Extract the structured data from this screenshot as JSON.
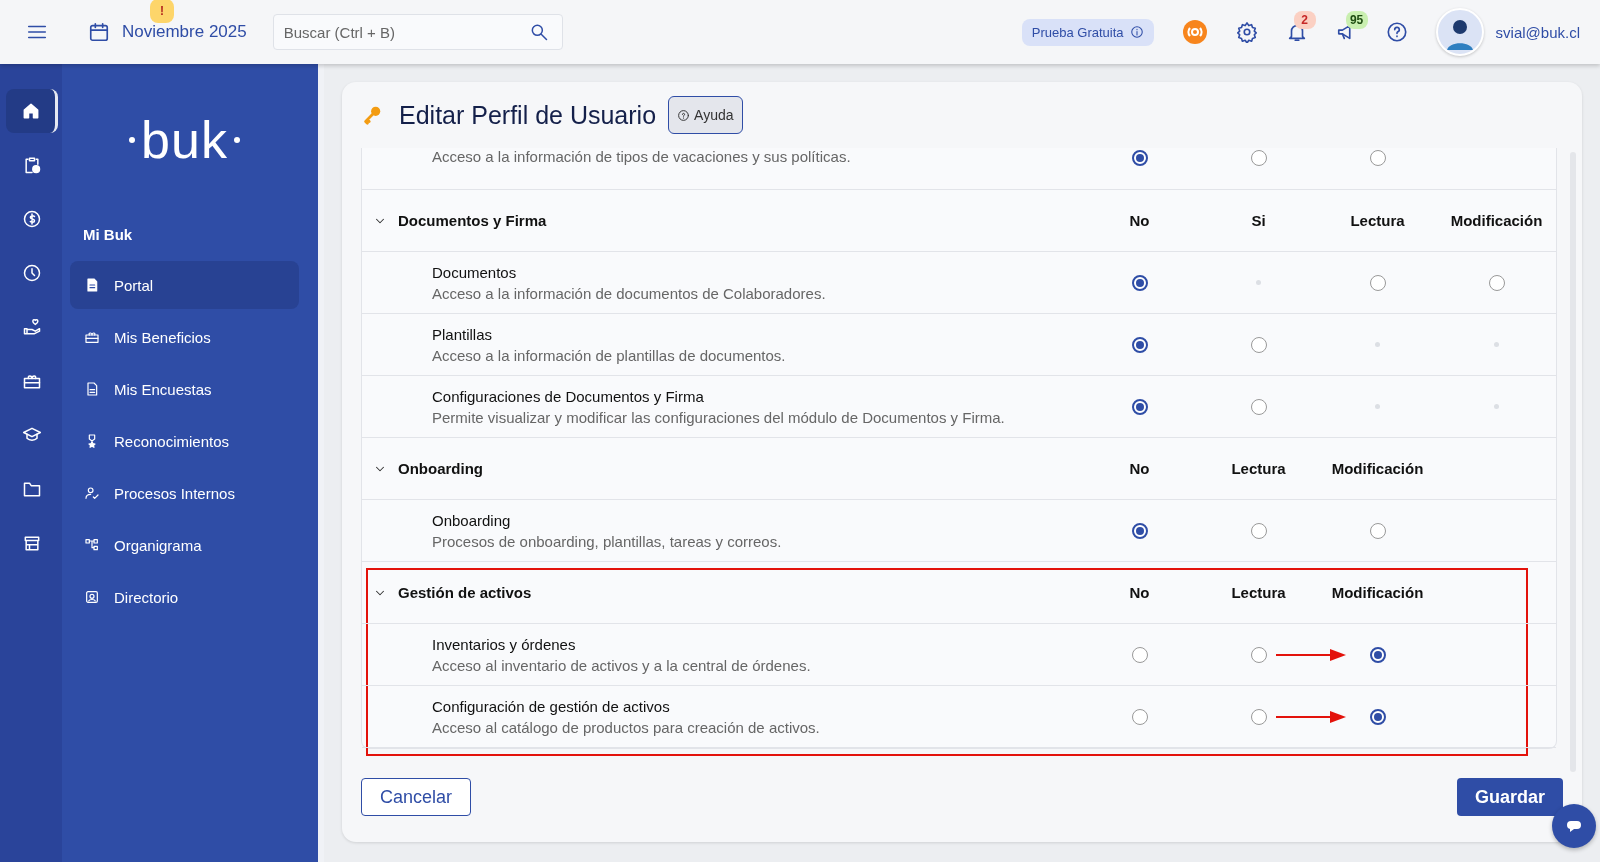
{
  "topbar": {
    "month": "Noviembre 2025",
    "alert_badge": "!",
    "search": {
      "placeholder": "Buscar (Ctrl + B)"
    },
    "trial": "Prueba Gratuita",
    "notifications_badge": "2",
    "announcements_badge": "95",
    "user": "svial@buk.cl"
  },
  "rail": [
    {
      "selected": true
    },
    {
      "selected": false
    },
    {
      "selected": false
    },
    {
      "selected": false
    },
    {
      "selected": false
    },
    {
      "selected": false
    },
    {
      "selected": false
    },
    {
      "selected": false
    },
    {
      "selected": false
    }
  ],
  "sidebar": {
    "logo": "buk",
    "section": "Mi Buk",
    "items": [
      {
        "label": "Portal",
        "selected": true
      },
      {
        "label": "Mis Beneficios",
        "selected": false
      },
      {
        "label": "Mis Encuestas",
        "selected": false
      },
      {
        "label": "Reconocimientos",
        "selected": false
      },
      {
        "label": "Procesos Internos",
        "selected": false
      },
      {
        "label": "Organigrama",
        "selected": false
      },
      {
        "label": "Directorio",
        "selected": false
      }
    ]
  },
  "page": {
    "title": "Editar Perfil de Usuario",
    "help": "Ayuda"
  },
  "permissions": {
    "leading_rows": [
      {
        "description": "Acceso a la información de tipos de vacaciones y sus políticas.",
        "options": [
          {
            "kind": "radio",
            "selected": true
          },
          {
            "kind": "radio",
            "selected": false
          },
          {
            "kind": "radio",
            "selected": false
          }
        ]
      }
    ],
    "groups": [
      {
        "title": "Documentos y Firma",
        "expanded": true,
        "highlighted": false,
        "columns": [
          "No",
          "Si",
          "Lectura",
          "Modificación"
        ],
        "rows": [
          {
            "name": "Documentos",
            "description": "Acceso a la información de documentos de Colaboradores.",
            "annotated": false,
            "options": [
              {
                "kind": "radio",
                "selected": true
              },
              {
                "kind": "unavailable"
              },
              {
                "kind": "radio",
                "selected": false
              },
              {
                "kind": "radio",
                "selected": false
              }
            ]
          },
          {
            "name": "Plantillas",
            "description": "Acceso a la información de plantillas de documentos.",
            "annotated": false,
            "options": [
              {
                "kind": "radio",
                "selected": true
              },
              {
                "kind": "radio",
                "selected": false
              },
              {
                "kind": "unavailable"
              },
              {
                "kind": "unavailable"
              }
            ]
          },
          {
            "name": "Configuraciones de Documentos y Firma",
            "description": "Permite visualizar y modificar las configuraciones del módulo de Documentos y Firma.",
            "annotated": false,
            "options": [
              {
                "kind": "radio",
                "selected": true
              },
              {
                "kind": "radio",
                "selected": false
              },
              {
                "kind": "unavailable"
              },
              {
                "kind": "unavailable"
              }
            ]
          }
        ]
      },
      {
        "title": "Onboarding",
        "expanded": true,
        "highlighted": false,
        "columns": [
          "No",
          "Lectura",
          "Modificación"
        ],
        "rows": [
          {
            "name": "Onboarding",
            "description": "Procesos de onboarding, plantillas, tareas y correos.",
            "annotated": false,
            "options": [
              {
                "kind": "radio",
                "selected": true
              },
              {
                "kind": "radio",
                "selected": false
              },
              {
                "kind": "radio",
                "selected": false
              }
            ]
          }
        ]
      },
      {
        "title": "Gestión de activos",
        "expanded": true,
        "highlighted": true,
        "columns": [
          "No",
          "Lectura",
          "Modificación"
        ],
        "rows": [
          {
            "name": "Inventarios y órdenes",
            "description": "Acceso al inventario de activos y a la central de órdenes.",
            "annotated": true,
            "options": [
              {
                "kind": "radio",
                "selected": false
              },
              {
                "kind": "radio",
                "selected": false
              },
              {
                "kind": "radio",
                "selected": true
              }
            ]
          },
          {
            "name": "Configuración de gestión de activos",
            "description": "Acceso al catálogo de productos para creación de activos.",
            "annotated": true,
            "options": [
              {
                "kind": "radio",
                "selected": false
              },
              {
                "kind": "radio",
                "selected": false
              },
              {
                "kind": "radio",
                "selected": true
              }
            ]
          }
        ]
      }
    ]
  },
  "actions": {
    "cancel": "Cancelar",
    "save": "Guardar"
  }
}
